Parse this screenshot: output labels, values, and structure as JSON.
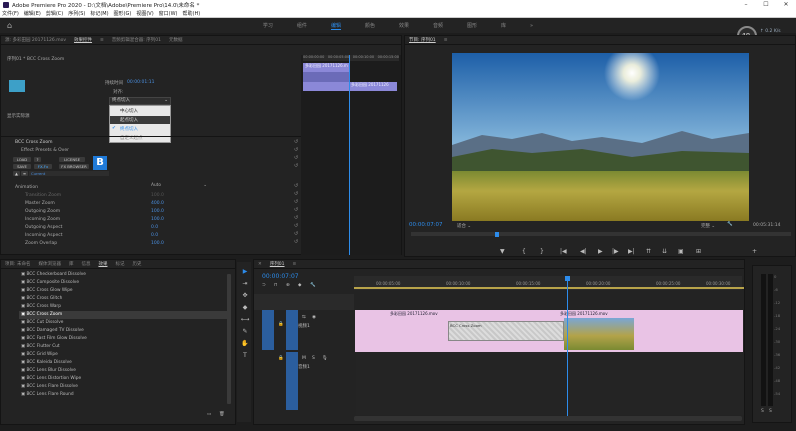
{
  "window": {
    "title": "Adobe Premiere Pro 2020 - D:\\文档\\Adobe\\Premiere Pro\\14.0\\未命名 *",
    "buttons": [
      "–",
      "☐",
      "✕"
    ]
  },
  "menu": [
    "文件(F)",
    "编辑(E)",
    "剪辑(C)",
    "序列(S)",
    "标记(M)",
    "图形(G)",
    "视图(V)",
    "窗口(W)",
    "帮助(H)"
  ],
  "workspaces": {
    "tabs": [
      "学习",
      "组件",
      "编辑",
      "颜色",
      "效果",
      "音频",
      "图形",
      "库"
    ],
    "active_index": 2,
    "more": "»"
  },
  "perf": {
    "value": "48",
    "unit": "x",
    "up": "0.2",
    "up_unit": "K/s",
    "down": "0.2",
    "down_unit": "K/s"
  },
  "source_panel": {
    "tabs": [
      "源: 多彩田园 20171126.mov",
      "效果控件",
      "音频剪辑混合器: 序列01",
      "元数据"
    ],
    "active_tab": 1,
    "menu_icon": "≡",
    "seq_label": "序列01 * BCC Cross Zoom",
    "duration_label": "持续时间",
    "duration_value": "00:00:01:11",
    "align_label": "对齐:",
    "align_value": "终点切入",
    "align_options": [
      "中心切入",
      "起点切入",
      "终点切入",
      "自定义起点"
    ],
    "start_label": "显示实际源",
    "fx_name": "BCC Cross Zoom",
    "fx_preset": "Effect Presets & Over",
    "buttons": [
      "LOAD",
      "?",
      "LICENSE",
      "SAVE",
      "FX-Fx",
      "FX BROWSER"
    ],
    "mode_value": "Current",
    "bcc_logo": "B",
    "params": [
      {
        "name": "Animation",
        "value": "Auto"
      },
      {
        "name": "Transition Zoom",
        "value": "100.0"
      },
      {
        "name": "Master Zoom",
        "value": "400.0"
      },
      {
        "name": "Outgoing Zoom",
        "value": "100.0"
      },
      {
        "name": "Incoming Zoom",
        "value": "100.0"
      },
      {
        "name": "Outgoing Aspect",
        "value": "0.0"
      },
      {
        "name": "Incoming Aspect",
        "value": "0.0"
      },
      {
        "name": "Zoom Overlap",
        "value": "100.0"
      }
    ]
  },
  "mini_timeline": {
    "ruler": [
      "00:00:00:00",
      "00:00:05:00",
      "00:00:10:00",
      "00:00:15:00"
    ],
    "clips": [
      "多彩田园 20171126.m",
      "",
      "多彩田园 20171126"
    ]
  },
  "program_panel": {
    "title": "节目: 序列01",
    "timecode": "00:00:07:07",
    "fit": "适合",
    "quality": "完整",
    "duration": "00:05:31:14",
    "controls": [
      "▶",
      "◀",
      "|◀",
      "◀|",
      "▶",
      "|▶",
      "▶▶",
      "⇆",
      "⇆",
      "📷",
      "⊞"
    ]
  },
  "project_panel": {
    "tabs": [
      "项目: 未命名",
      "媒体浏览器",
      "库",
      "信息",
      "效果",
      "标记",
      "历史"
    ],
    "active_tab": 4,
    "items": [
      "BCC Checkerboard Dissolve",
      "BCC Composite Dissolve",
      "BCC Cross Glow Wipe",
      "BCC Cross Glitch",
      "BCC Cross Warp",
      "BCC Cross Zoom",
      "BCC Cut Dissolve",
      "BCC Damaged TV Dissolve",
      "BCC Fast Film Glow Dissolve",
      "BCC Flutter Cut",
      "BCC Grid Wipe",
      "BCC Kaleida Dissolve",
      "BCC Lens Blur Dissolve",
      "BCC Lens Distortion Wipe",
      "BCC Lens Flare Dissolve",
      "BCC Lens Flare Round"
    ],
    "selected_index": 5
  },
  "tools": [
    "▶",
    "⇥",
    "✥",
    "◆",
    "⟷",
    "✎",
    "✋",
    "T"
  ],
  "timeline": {
    "tab": "序列01",
    "timecode": "00:00:07:07",
    "ruler": [
      "00:00:00",
      "00:00:05:00",
      "00:00:10:00",
      "00:00:15:00",
      "00:00:20:00",
      "00:00:25:00",
      "00:00:30:00",
      "00:00:35:00"
    ],
    "tracks": [
      {
        "name": "V1",
        "label": "视频1"
      },
      {
        "name": "A1",
        "label": "音频1"
      }
    ],
    "clips": {
      "v1a": "多彩田园 20171126.mov",
      "trans": "BCC Cross Zoom",
      "v1b": "多彩田园 20171126.mov"
    }
  },
  "meter": {
    "ticks": [
      "0",
      "-6",
      "-12",
      "-18",
      "-24",
      "-30",
      "-36",
      "-42",
      "-48",
      "-54"
    ],
    "solo": [
      "S",
      "S"
    ]
  },
  "colors": {
    "accent": "#2d8ceb",
    "clip_pink": "#e9c3e5",
    "clip_blue": "#8b88d8",
    "timecode": "#2d8ceb"
  }
}
